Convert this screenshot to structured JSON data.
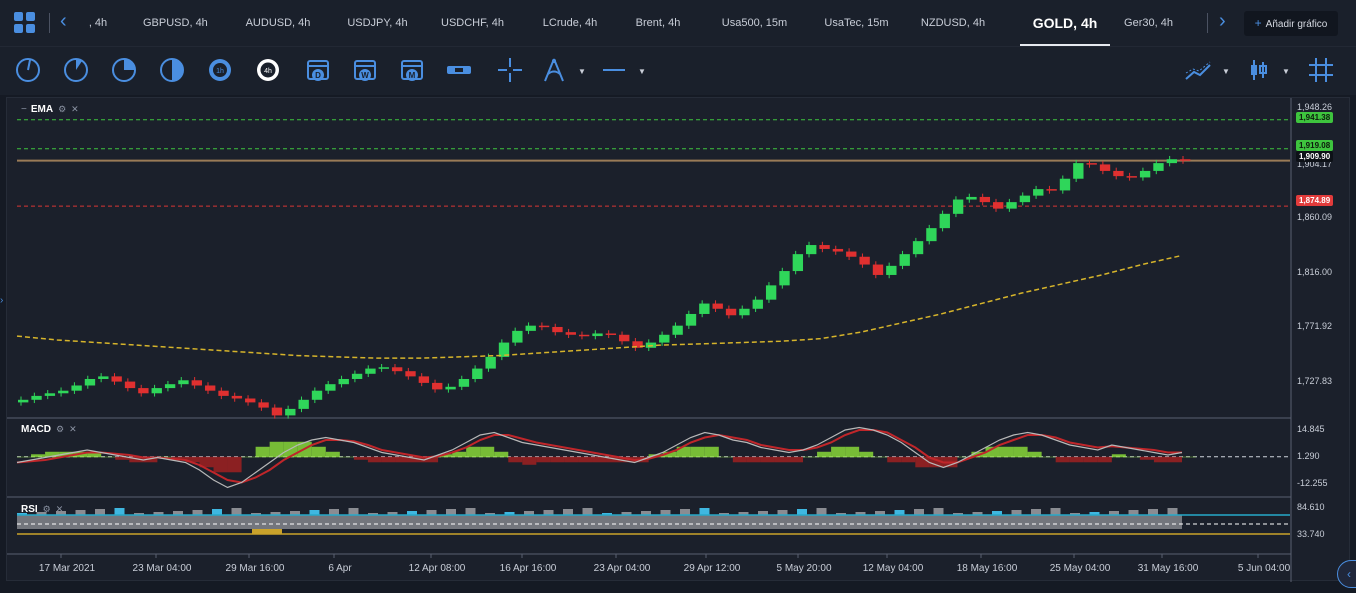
{
  "tabs": [
    ", 4h",
    "GBPUSD, 4h",
    "AUDUSD, 4h",
    "USDJPY, 4h",
    "USDCHF, 4h",
    "LCrude, 4h",
    "Brent, 4h",
    "Usa500, 15m",
    "UsaTec, 15m",
    "NZDUSD, 4h",
    "GOLD, 4h",
    "Ger30, 4h"
  ],
  "active_tab_index": 10,
  "add_chart_label": "Añadir gráfico",
  "icons": {
    "layout": "grid-icon",
    "prev": "chevron-left-icon",
    "next": "chevron-right-icon",
    "tools": [
      "1m-period-icon",
      "5m-period-icon",
      "15m-period-icon",
      "30m-period-icon",
      "1h-period-icon",
      "4h-period-icon",
      "daily-calendar-icon",
      "weekly-calendar-icon",
      "monthly-calendar-icon",
      "range-icon",
      "crosshair-icon",
      "drawing-tools-icon",
      "line-style-icon",
      "indicators-icon",
      "candle-type-icon",
      "grid-toggle-icon"
    ]
  },
  "tool_letters": {
    "h1": "1h",
    "h4": "4h",
    "d": "D",
    "w": "W",
    "m": "M"
  },
  "panels": {
    "ema": "EMA",
    "macd": "MACD",
    "rsi": "RSI"
  },
  "price_axis": [
    "1,948.26",
    "1,904.17",
    "1,860.09",
    "1,816.00",
    "1,771.92",
    "1,727.83"
  ],
  "price_tags": [
    {
      "label": "1,941.38",
      "color": "#5fd35f"
    },
    {
      "label": "1,919.08",
      "color": "#5fd35f"
    },
    {
      "label": "1,909.90",
      "color": "#ffffff"
    },
    {
      "label": "1,874.89",
      "color": "#e23b3b"
    }
  ],
  "macd_axis": [
    "14.845",
    "1.290",
    "-12.255"
  ],
  "rsi_axis": [
    "84.610",
    "33.740"
  ],
  "x_axis": [
    "17 Mar 2021",
    "23 Mar 04:00",
    "29 Mar 16:00",
    "6 Apr",
    "12 Apr 08:00",
    "16 Apr 16:00",
    "23 Apr 04:00",
    "29 Apr 12:00",
    "5 May 20:00",
    "12 May 04:00",
    "18 May 16:00",
    "25 May 04:00",
    "31 May 16:00",
    "5 Jun 04:00"
  ],
  "chart_data": {
    "type": "candlestick",
    "symbol": "GOLD",
    "timeframe": "4h",
    "price_range": [
      1712,
      1955
    ],
    "candle_closes": [
      1726,
      1729,
      1731,
      1733,
      1737,
      1742,
      1744,
      1740,
      1735,
      1731,
      1735,
      1738,
      1741,
      1737,
      1733,
      1729,
      1727,
      1724,
      1720,
      1714,
      1719,
      1726,
      1733,
      1738,
      1742,
      1746,
      1750,
      1751,
      1748,
      1744,
      1739,
      1734,
      1736,
      1742,
      1750,
      1759,
      1770,
      1779,
      1783,
      1782,
      1778,
      1776,
      1775,
      1777,
      1776,
      1771,
      1766,
      1770,
      1776,
      1783,
      1792,
      1800,
      1796,
      1791,
      1796,
      1803,
      1814,
      1825,
      1838,
      1845,
      1842,
      1840,
      1836,
      1830,
      1822,
      1829,
      1838,
      1848,
      1858,
      1869,
      1880,
      1882,
      1878,
      1873,
      1878,
      1883,
      1888,
      1887,
      1896,
      1908,
      1907,
      1902,
      1898,
      1897,
      1902,
      1908,
      1911,
      1910
    ],
    "ema_line": [
      1775,
      1772,
      1770,
      1768,
      1766,
      1764,
      1762,
      1760,
      1759,
      1758,
      1758,
      1759,
      1760,
      1762,
      1764,
      1766,
      1768,
      1769,
      1770,
      1771,
      1773,
      1778,
      1785,
      1792,
      1800,
      1808,
      1815,
      1822,
      1830,
      1837
    ],
    "horizontal_levels": [
      {
        "value": 1941.38,
        "style": "dashed",
        "color": "#3ec43e"
      },
      {
        "value": 1919.08,
        "style": "dashed",
        "color": "#3ec43e"
      },
      {
        "value": 1909.9,
        "style": "solid",
        "color": "#9a7b57"
      },
      {
        "value": 1874.89,
        "style": "dashed",
        "color": "#d83535"
      }
    ],
    "macd_range": [
      -14,
      16
    ],
    "macd_line": [
      -1,
      0,
      1,
      2,
      3,
      4,
      3,
      2,
      1,
      0,
      1,
      0,
      -1,
      -4,
      -8,
      -11,
      -9,
      -5,
      -1,
      3,
      6,
      8,
      9,
      8,
      7,
      5,
      3,
      2,
      1,
      0,
      2,
      4,
      7,
      10,
      11,
      9,
      7,
      6,
      5,
      4,
      3,
      2,
      1,
      0,
      -1,
      1,
      3,
      6,
      9,
      11,
      10,
      8,
      7,
      5,
      4,
      3,
      4,
      6,
      9,
      12,
      13,
      12,
      10,
      7,
      3,
      -1,
      -3,
      -1,
      2,
      5,
      8,
      10,
      11,
      10,
      8,
      6,
      5,
      4,
      6,
      5,
      4,
      3,
      2,
      3
    ],
    "signal_line": [
      -1,
      -0.5,
      0,
      1,
      2,
      3,
      3,
      2.5,
      2,
      1,
      1,
      0.5,
      0,
      -2,
      -5,
      -8,
      -9,
      -7,
      -4,
      0,
      3,
      6,
      8,
      8,
      7.5,
      6,
      4,
      3,
      2,
      1,
      1.5,
      3,
      5,
      8,
      10,
      10,
      8.5,
      7,
      6,
      5,
      4,
      3,
      2,
      1,
      0,
      0.5,
      2,
      4,
      7,
      9,
      10,
      9,
      8,
      6,
      5,
      4,
      4,
      5,
      7,
      10,
      12,
      12,
      11,
      8,
      5,
      1,
      -1,
      -1,
      1,
      3,
      6,
      8,
      10,
      10,
      9,
      7,
      6,
      5,
      5.5,
      5,
      4.5,
      4,
      3,
      3
    ]
  }
}
